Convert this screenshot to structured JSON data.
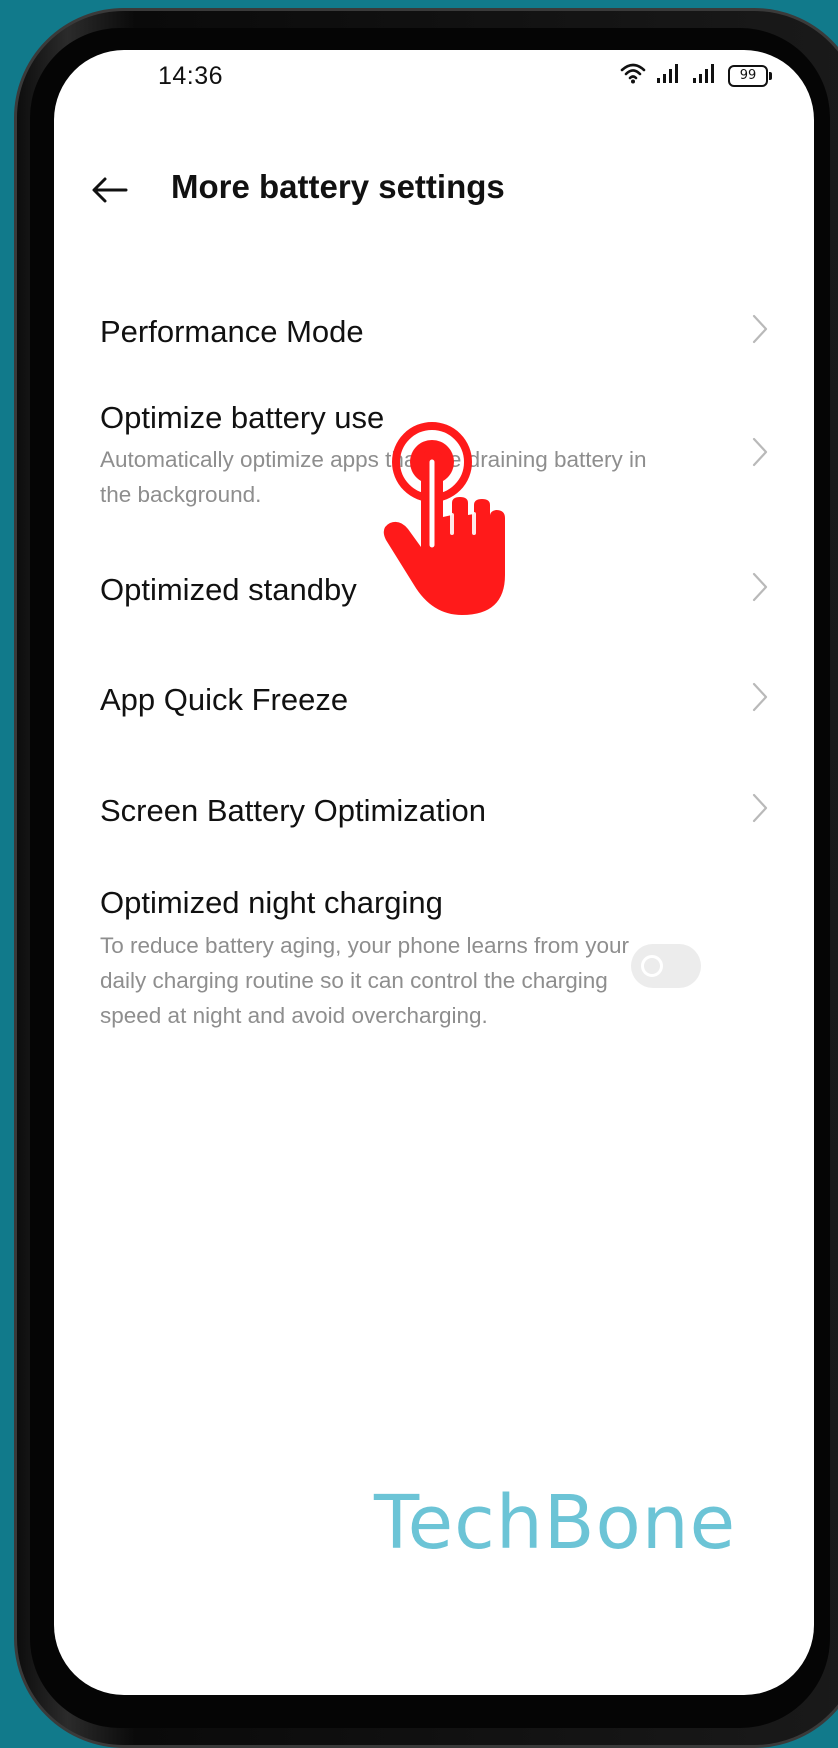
{
  "status_bar": {
    "time": "14:36",
    "battery_level": "99",
    "icons": [
      "wifi-icon",
      "signal-icon",
      "signal-icon",
      "battery-icon"
    ]
  },
  "header": {
    "title": "More battery settings",
    "back_icon": "arrow-left-icon"
  },
  "settings": [
    {
      "title": "Performance Mode",
      "subtitle": "",
      "control": "chevron"
    },
    {
      "title": "Optimize battery use",
      "subtitle": "Automatically optimize apps that are draining battery in the background.",
      "control": "chevron"
    },
    {
      "title": "Optimized standby",
      "subtitle": "",
      "control": "chevron"
    },
    {
      "title": "App Quick Freeze",
      "subtitle": "",
      "control": "chevron"
    },
    {
      "title": "Screen Battery Optimization",
      "subtitle": "",
      "control": "chevron"
    },
    {
      "title": "Optimized night charging",
      "subtitle": "To reduce battery aging, your phone learns from your daily charging routine so it can control the charging speed at night and avoid overcharging.",
      "control": "toggle",
      "toggle_on": false
    }
  ],
  "overlay": {
    "tap_indicator_icon": "tap-hand-icon",
    "tap_color": "#ff1a1a"
  },
  "watermark": "TechBone",
  "colors": {
    "background": "#117a8b",
    "watermark": "#6cc4d6",
    "subtitle": "#8e8e8e"
  }
}
